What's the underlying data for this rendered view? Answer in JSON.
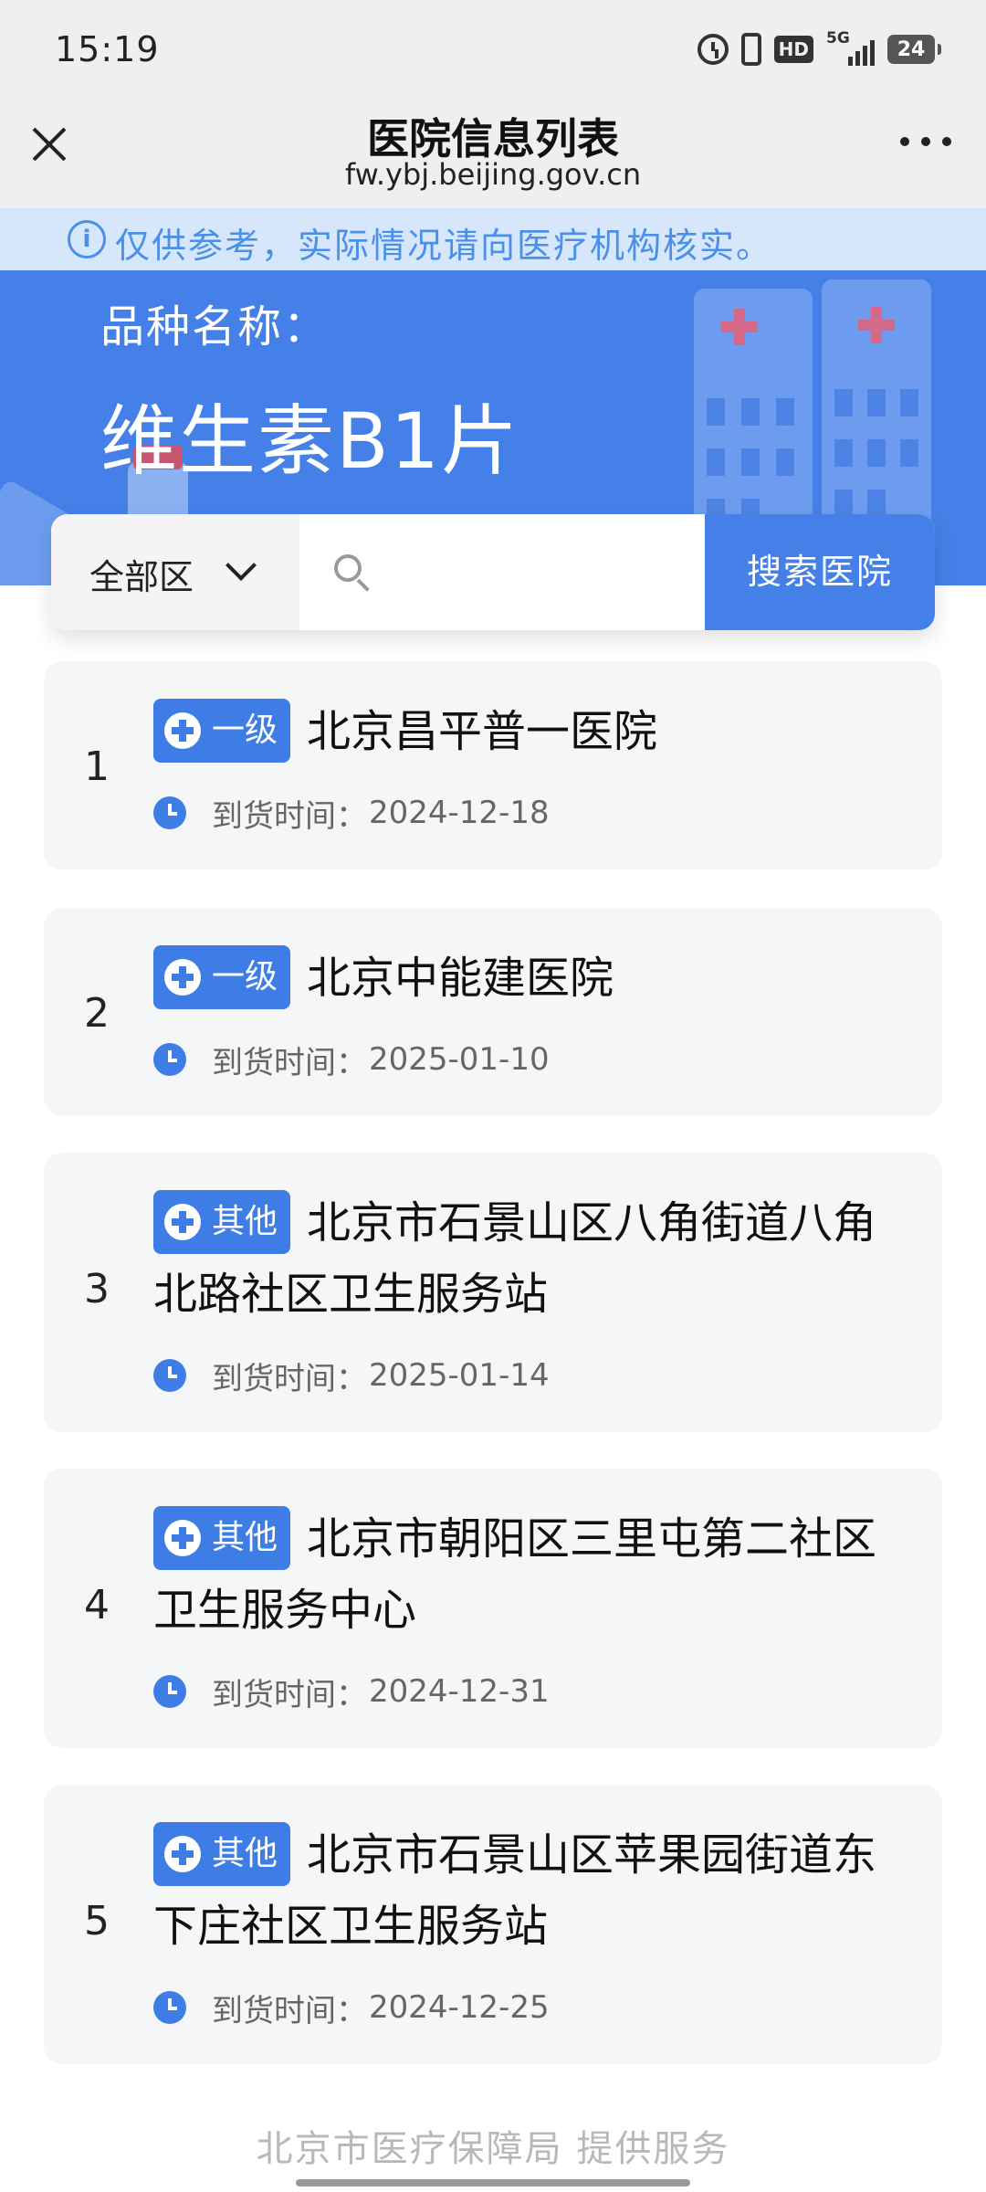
{
  "status_bar": {
    "time": "15:19",
    "signal_label": "5G",
    "battery": "24",
    "hd_label": "HD"
  },
  "nav": {
    "title": "医院信息列表",
    "subtitle": "fw.ybj.beijing.gov.cn"
  },
  "notice": {
    "icon": "i",
    "text": "仅供参考，实际情况请向医疗机构核实。"
  },
  "hero": {
    "label": "品种名称：",
    "drug_name": "维生素B1片"
  },
  "search": {
    "district": "全部区",
    "placeholder": "",
    "button_label": "搜索医院"
  },
  "list": {
    "time_label": "到货时间：",
    "items": [
      {
        "index": "1",
        "level": "一级",
        "name": "北京昌平普一医院",
        "arrival": "2024-12-18"
      },
      {
        "index": "2",
        "level": "一级",
        "name": "北京中能建医院",
        "arrival": "2025-01-10"
      },
      {
        "index": "3",
        "level": "其他",
        "name": "北京市石景山区八角街道八角北路社区卫生服务站",
        "arrival": "2025-01-14"
      },
      {
        "index": "4",
        "level": "其他",
        "name": "北京市朝阳区三里屯第二社区卫生服务中心",
        "arrival": "2024-12-31"
      },
      {
        "index": "5",
        "level": "其他",
        "name": "北京市石景山区苹果园街道东下庄社区卫生服务站",
        "arrival": "2024-12-25"
      }
    ]
  },
  "footer": {
    "text": "北京市医疗保障局  提供服务"
  },
  "colors": {
    "accent": "#4580e8",
    "badge": "#3f7de6",
    "notice_bg": "#d7e7fb",
    "card_bg": "#f5f6f7"
  }
}
